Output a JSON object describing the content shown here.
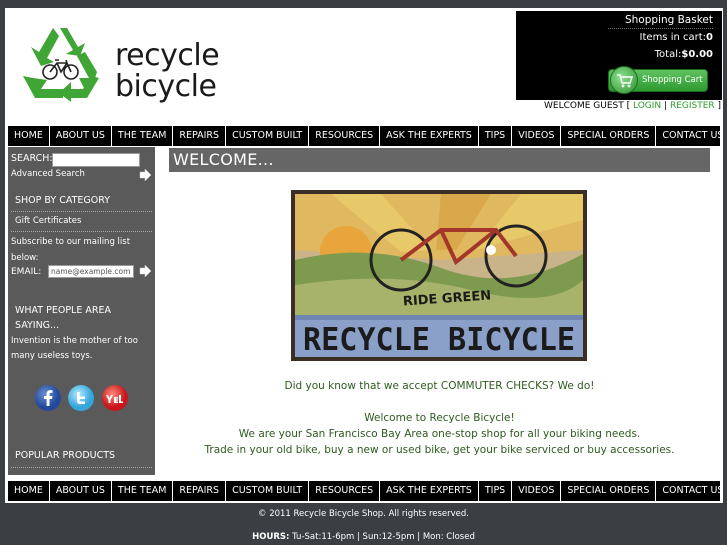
{
  "logo": {
    "line1": "recycle",
    "line2": "bicycle"
  },
  "cart": {
    "title": "Shopping Basket",
    "items_label": "Items in cart:",
    "items_value": "0",
    "total_label": "Total:",
    "total_value": "$0.00",
    "button_label": "Shopping Cart"
  },
  "user": {
    "welcome": "WELCOME GUEST [",
    "login": "LOGIN",
    "sep": "|",
    "register": "REGISTER",
    "close": "]"
  },
  "nav": [
    "HOME",
    "ABOUT US",
    "THE TEAM",
    "REPAIRS",
    "CUSTOM BUILT",
    "RESOURCES",
    "ASK THE EXPERTS",
    "TIPS",
    "VIDEOS",
    "SPECIAL ORDERS",
    "CONTACT US"
  ],
  "sidebar": {
    "search_label": "SEARCH:",
    "advanced_search": "Advanced Search",
    "shop_by_category": "SHOP BY CATEGORY",
    "gift_certificates": "Gift Certificates",
    "mailing_line1": "Subscribe to our mailing list",
    "mailing_line2": "below:",
    "email_label": "EMAIL:",
    "email_placeholder": "name@example.com",
    "people_saying_1": "WHAT PEOPLE AREA",
    "people_saying_2": "SAYING...",
    "quote_line1": "Invention is the mother of too",
    "quote_line2": "many useless toys.",
    "popular_products": "POPULAR PRODUCTS"
  },
  "main": {
    "title": "WELCOME...",
    "mosaic_text1": "RIDE GREEN",
    "mosaic_text2": "RECYCLE BICYCLE",
    "commuter": "Did you know that we accept COMMUTER CHECKS?   We do!",
    "welcome_line": "Welcome to Recycle Bicycle!",
    "line2": "We are your San Francisco Bay Area one-stop shop for all your biking needs.",
    "line3": "Trade in your old bike, buy a new or used bike, get your bike serviced or buy accessories."
  },
  "footer": {
    "copyright": "© 2011 Recycle Bicycle Shop. All rights reserved.",
    "hours_label": "HOURS:",
    "hours_value": "Tu-Sat:11-6pm | Sun:12-5pm | Mon: Closed"
  },
  "colors": {
    "green": "#2e9a2e",
    "nav_bg": "#000000",
    "sidebar_bg": "#5a5a5a",
    "page_bg": "#3b3f44"
  }
}
